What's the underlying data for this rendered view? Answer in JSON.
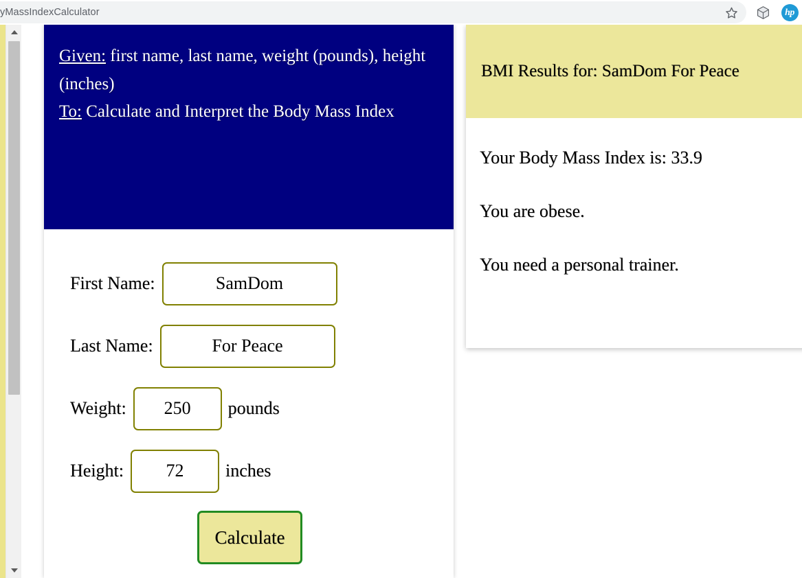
{
  "browser": {
    "address_text": "yMassIndexCalculator",
    "icons": {
      "bookmark": "star-icon",
      "extension": "cube-icon",
      "profile": "hp-logo-icon",
      "profile_label": "hp"
    }
  },
  "form_card": {
    "header": {
      "given_label": "Given:",
      "given_text": " first name, last name, weight (pounds), height (inches)",
      "to_label": "To:",
      "to_text": " Calculate and Interpret the Body Mass Index"
    },
    "fields": [
      {
        "label": "First Name:",
        "value": "SamDom",
        "suffix": "",
        "name": "first-name"
      },
      {
        "label": "Last Name:",
        "value": "For Peace",
        "suffix": "",
        "name": "last-name"
      },
      {
        "label": "Weight:",
        "value": "250",
        "suffix": "pounds",
        "name": "weight"
      },
      {
        "label": "Height:",
        "value": "72",
        "suffix": "inches",
        "name": "height"
      }
    ],
    "calculate_label": "Calculate"
  },
  "results_card": {
    "title": "BMI Results for: SamDom For Peace",
    "lines": [
      "Your Body Mass Index is: 33.9",
      "You are obese.",
      "You need a personal trainer."
    ],
    "bmi_value": "33.9"
  },
  "colors": {
    "header_navy": "#000080",
    "khaki": "#ece79b",
    "input_border_olive": "#808000",
    "button_border_green": "#228b22",
    "page_edge_yellow": "#ebe48b",
    "scrollbar_thumb": "#c1c1c1",
    "hp_blue": "#1f9ad6"
  }
}
